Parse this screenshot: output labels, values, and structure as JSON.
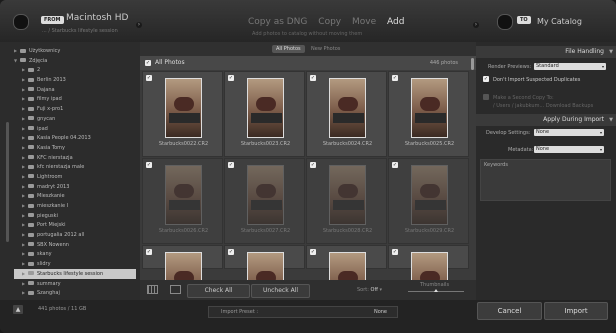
{
  "header": {
    "from_label": "FROM",
    "source_name": "Macintosh HD",
    "source_path": "... / Starbucks lifestyle session",
    "modes": [
      "Copy as DNG",
      "Copy",
      "Move",
      "Add"
    ],
    "active_mode": "Add",
    "mode_description": "Add photos to catalog without moving them",
    "to_label": "TO",
    "destination": "My Catalog"
  },
  "tree": [
    {
      "label": "Użytkownicy",
      "indent": 0,
      "open": false
    },
    {
      "label": "Zdjęcia",
      "indent": 0,
      "open": true
    },
    {
      "label": "2",
      "indent": 1,
      "open": false
    },
    {
      "label": "Berlin 2013",
      "indent": 1,
      "open": false
    },
    {
      "label": "Dajana",
      "indent": 1,
      "open": false
    },
    {
      "label": "filmy ipad",
      "indent": 1,
      "open": false
    },
    {
      "label": "Fuji x-pro1",
      "indent": 1,
      "open": false
    },
    {
      "label": "gnycan",
      "indent": 1,
      "open": false
    },
    {
      "label": "ipad",
      "indent": 1,
      "open": false
    },
    {
      "label": "Kasia People 04.2013",
      "indent": 1,
      "open": false
    },
    {
      "label": "Kasia Tomy",
      "indent": 1,
      "open": false
    },
    {
      "label": "KFC nierstazja",
      "indent": 1,
      "open": false
    },
    {
      "label": "kfc nierstazja male",
      "indent": 1,
      "open": false
    },
    {
      "label": "Lightroom",
      "indent": 1,
      "open": false
    },
    {
      "label": "madryt 2013",
      "indent": 1,
      "open": false
    },
    {
      "label": "Mieszkanie",
      "indent": 1,
      "open": false
    },
    {
      "label": "mieszkanie I",
      "indent": 1,
      "open": false
    },
    {
      "label": "pieguski",
      "indent": 1,
      "open": false
    },
    {
      "label": "Port Miejski",
      "indent": 1,
      "open": false
    },
    {
      "label": "portugalia 2012 all",
      "indent": 1,
      "open": false
    },
    {
      "label": "SBX Nowenn",
      "indent": 1,
      "open": false
    },
    {
      "label": "skany",
      "indent": 1,
      "open": false
    },
    {
      "label": "slidry",
      "indent": 1,
      "open": false
    },
    {
      "label": "Starbucks lifestyle session",
      "indent": 1,
      "open": false,
      "selected": true
    },
    {
      "label": "summary",
      "indent": 1,
      "open": false
    },
    {
      "label": "Szanghaj",
      "indent": 1,
      "open": false
    }
  ],
  "center": {
    "tabs": [
      "All Photos",
      "New Photos"
    ],
    "active_tab": "All Photos",
    "grid_title": "All Photos",
    "photo_count": "446 photos",
    "photos": [
      {
        "name": "Starbucks0022.CR2",
        "checked": true,
        "dim": false
      },
      {
        "name": "Starbucks0023.CR2",
        "checked": true,
        "dim": false
      },
      {
        "name": "Starbucks0024.CR2",
        "checked": true,
        "dim": false
      },
      {
        "name": "Starbucks0025.CR2",
        "checked": true,
        "dim": false
      },
      {
        "name": "Starbucks0026.CR2",
        "checked": true,
        "dim": true
      },
      {
        "name": "Starbucks0027.CR2",
        "checked": true,
        "dim": true
      },
      {
        "name": "Starbucks0028.CR2",
        "checked": true,
        "dim": true
      },
      {
        "name": "Starbucks0029.CR2",
        "checked": true,
        "dim": true
      },
      {
        "name": "",
        "checked": true,
        "dim": false
      },
      {
        "name": "",
        "checked": true,
        "dim": false
      },
      {
        "name": "",
        "checked": true,
        "dim": false
      },
      {
        "name": "",
        "checked": true,
        "dim": false
      }
    ]
  },
  "toolbar": {
    "check_all": "Check All",
    "uncheck_all": "Uncheck All",
    "sort_label": "Sort:",
    "sort_value": "Off",
    "thumbnails_label": "Thumbnails",
    "thumbnail_level": 0.5
  },
  "right": {
    "file_handling": "File Handling",
    "render_previews_label": "Render Previews:",
    "render_previews_value": "Standard",
    "dont_import_dupes": "Don't Import Suspected Duplicates",
    "second_copy": "Make a Second Copy To:",
    "second_copy_path": "/ Users / jakubkum... Download Backups",
    "apply_during_import": "Apply During Import",
    "develop_label": "Develop Settings:",
    "develop_value": "None",
    "metadata_label": "Metadata:",
    "metadata_value": "None",
    "keywords_label": "Keywords"
  },
  "bottom": {
    "count": "441 photos / 11 GB",
    "import_preset_label": "Import Preset :",
    "import_preset_value": "None",
    "cancel": "Cancel",
    "import": "Import"
  }
}
